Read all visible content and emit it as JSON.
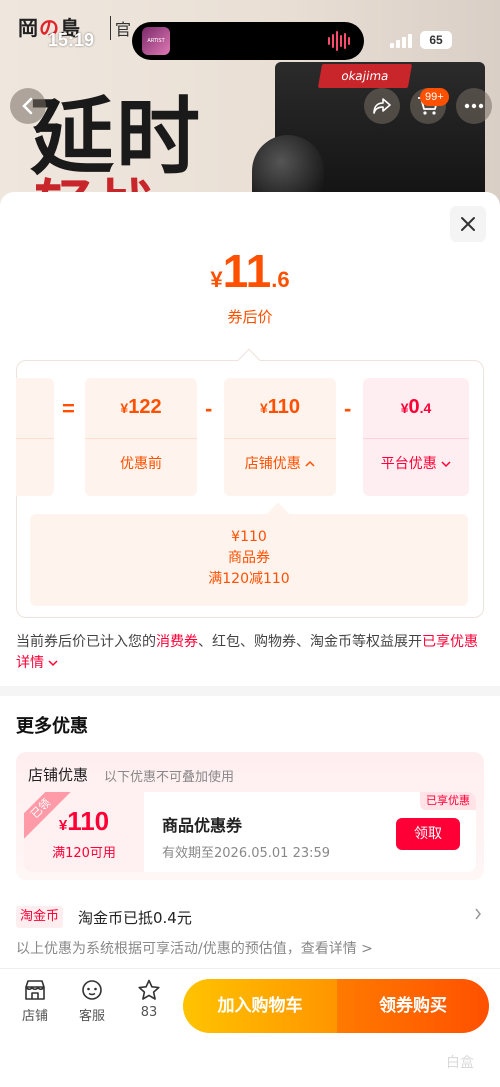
{
  "background": {
    "logo_left": "岡",
    "logo_no": "の",
    "logo_right": "島",
    "logo_sub": "官",
    "headline1": "延时",
    "headline2": "轻战",
    "product_brand": "okajima",
    "cart_badge": "99+"
  },
  "status_bar": {
    "time": "15:19",
    "battery": "65",
    "now_playing_art": "ARTIST"
  },
  "sheet": {
    "price": {
      "currency": "¥",
      "integer": "11",
      "decimal": ".6",
      "label": "券后价"
    },
    "calc": {
      "equals": "=",
      "minus": "-",
      "original": {
        "currency": "¥",
        "value": "122",
        "label": "优惠前"
      },
      "shop_discount": {
        "currency": "¥",
        "value": "110",
        "label": "店铺优惠"
      },
      "platform_discount": {
        "currency": "¥",
        "int": "0",
        "dec": ".4",
        "label": "平台优惠"
      }
    },
    "coupon_detail": {
      "amount": "¥110",
      "type": "商品券",
      "rule": "满120减110"
    },
    "note": {
      "before": "当前券后价已计入您的",
      "highlight": "消费券",
      "after": "、红包、购物券、淘金币等权益展开",
      "link": "已享优惠详情"
    },
    "more": {
      "title": "更多优惠",
      "shop_title": "店铺优惠",
      "shop_sub": "以下优惠不可叠加使用",
      "coupon": {
        "stamp": "已领",
        "currency": "¥",
        "value": "110",
        "condition": "满120可用",
        "name": "商品优惠券",
        "expiry": "有效期至2026.05.01 23:59",
        "enjoyed": "已享优惠",
        "claim": "领取"
      },
      "coin_tag": "淘金币",
      "coin_text": "淘金币已抵0.4元",
      "disclaimer": "以上优惠为系统根据可享活动/优惠的预估值，查看详情 >"
    },
    "bottom_bar": {
      "shop": "店铺",
      "service": "客服",
      "favorites": "83",
      "add_cart": "加入购物车",
      "buy": "领券购买"
    },
    "watermark": "白盒"
  },
  "colors": {
    "accent": "#ff5000",
    "red": "#ff0036",
    "cart_gradient_start": "#ffc300",
    "buy_gradient_end": "#ff5000"
  }
}
